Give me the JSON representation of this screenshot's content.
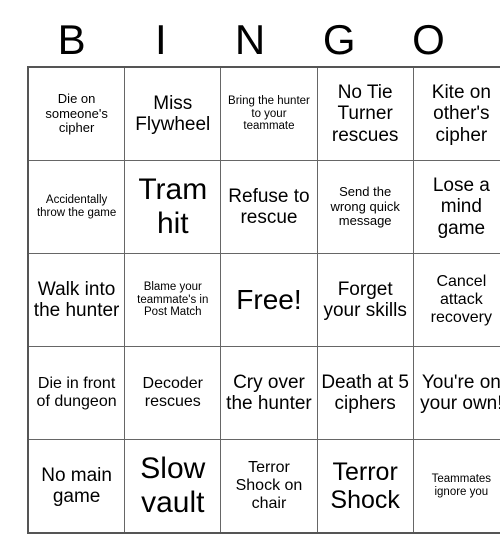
{
  "card": {
    "header_letters": [
      "B",
      "I",
      "N",
      "G",
      "O"
    ],
    "rows": [
      [
        {
          "text": "Die on someone's cipher",
          "size": "sz-s"
        },
        {
          "text": "Miss Flywheel",
          "size": "sz-l"
        },
        {
          "text": "Bring the hunter to your teammate",
          "size": "sz-xs"
        },
        {
          "text": "No Tie Turner rescues",
          "size": "sz-l"
        },
        {
          "text": "Kite on other's cipher",
          "size": "sz-l"
        }
      ],
      [
        {
          "text": "Accidentally throw the game",
          "size": "sz-xs"
        },
        {
          "text": "Tram hit",
          "size": "sz-xxl"
        },
        {
          "text": "Refuse to rescue",
          "size": "sz-l"
        },
        {
          "text": "Send the wrong quick message",
          "size": "sz-s"
        },
        {
          "text": "Lose a mind game",
          "size": "sz-l"
        }
      ],
      [
        {
          "text": "Walk into the hunter",
          "size": "sz-l"
        },
        {
          "text": "Blame your teammate's in Post Match",
          "size": "sz-xs"
        },
        {
          "text": "Free!",
          "size": "free-cell"
        },
        {
          "text": "Forget your skills",
          "size": "sz-l"
        },
        {
          "text": "Cancel attack recovery",
          "size": "sz-m"
        }
      ],
      [
        {
          "text": "Die in front of dungeon",
          "size": "sz-m"
        },
        {
          "text": "Decoder rescues",
          "size": "sz-m"
        },
        {
          "text": "Cry over the hunter",
          "size": "sz-l"
        },
        {
          "text": "Death at 5 ciphers",
          "size": "sz-l"
        },
        {
          "text": "You're on your own!",
          "size": "sz-l"
        }
      ],
      [
        {
          "text": "No main game",
          "size": "sz-l"
        },
        {
          "text": "Slow vault",
          "size": "sz-xxl"
        },
        {
          "text": "Terror Shock on chair",
          "size": "sz-m"
        },
        {
          "text": "Terror Shock",
          "size": "sz-xl"
        },
        {
          "text": "Teammates ignore you",
          "size": "sz-xs"
        }
      ]
    ]
  }
}
